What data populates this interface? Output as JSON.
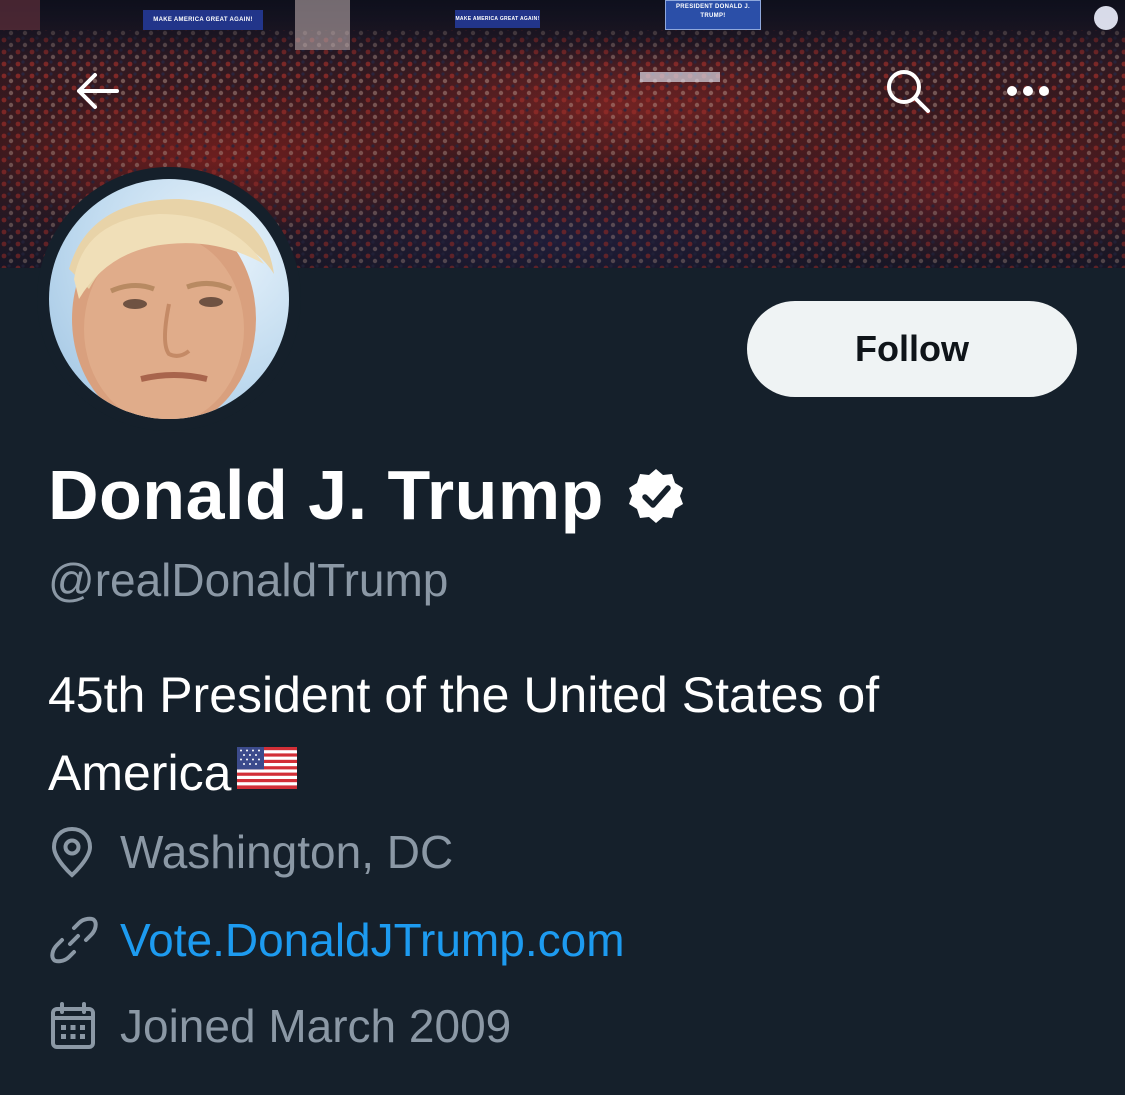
{
  "header": {
    "banner_signs": [
      "MAKE AMERICA GREAT AGAIN!",
      "MAKE AMERICA GREAT AGAIN!",
      "PRESIDENT DONALD J. TRUMP!"
    ],
    "back_icon": "arrow-left-icon",
    "search_icon": "search-icon",
    "more_icon": "more-horizontal-icon"
  },
  "profile": {
    "follow_label": "Follow",
    "name": "Donald J. Trump",
    "verified_icon": "verified-badge-icon",
    "handle": "@realDonaldTrump",
    "bio": "45th President of the United States of America",
    "bio_emoji": "us-flag-emoji",
    "location": "Washington, DC",
    "website": "Vote.DonaldJTrump.com",
    "joined": "Joined March 2009"
  },
  "colors": {
    "background": "#15202b",
    "text": "#ffffff",
    "secondary_text": "#8b98a5",
    "link": "#1d9bf0",
    "follow_button_bg": "#eff3f4"
  }
}
